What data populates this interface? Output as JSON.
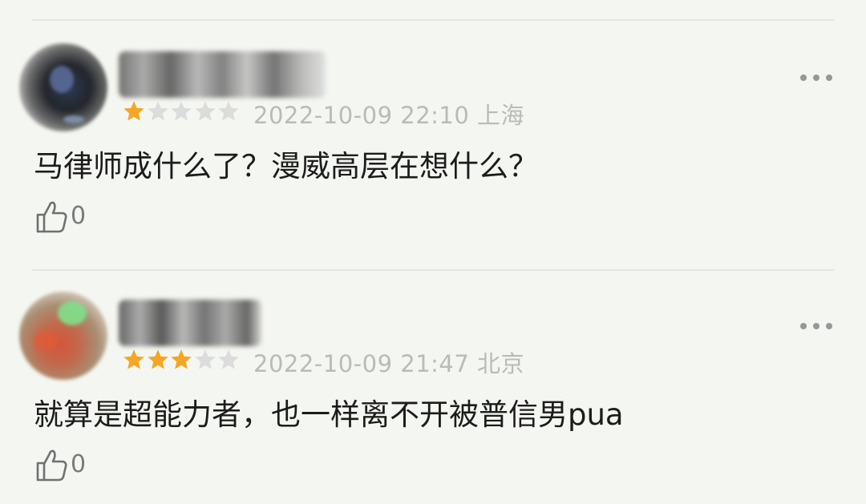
{
  "comments": [
    {
      "rating": 1,
      "rating_max": 5,
      "meta": "2022-10-09 22:10 上海",
      "text": "马律师成什么了？漫威高层在想什么？",
      "like_count": "0"
    },
    {
      "rating": 3,
      "rating_max": 5,
      "meta": "2022-10-09 21:47 北京",
      "text": "就算是超能力者，也一样离不开被普信男pua",
      "like_count": "0"
    }
  ],
  "colors": {
    "star_filled": "#f5a623",
    "star_empty": "#dcdcdc",
    "meta_text": "#b9bbb6",
    "body_text": "#1c1c1c"
  },
  "icons": {
    "more": "more-dots-icon",
    "like": "thumbs-up-icon",
    "star": "star-icon"
  }
}
